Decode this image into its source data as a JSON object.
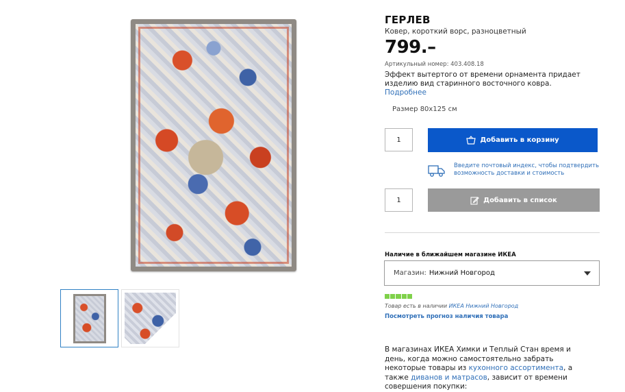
{
  "product": {
    "name": "ГЕРЛЕВ",
    "subtitle": "Ковер, короткий ворс, разноцветный",
    "price": "799.–",
    "article": "Артикульный номер: 403.408.18",
    "description": "Эффект вытертого от времени орнамента придает изделию вид старинного восточного ковра.",
    "more_link": "Подробнее",
    "size": "Размер 80x125 см"
  },
  "gallery": {
    "main_image": "rug-front-image",
    "thumbnails": [
      "rug-thumbnail-front",
      "rug-thumbnail-detail"
    ]
  },
  "purchase": {
    "qty_cart": "1",
    "cart_button": "Добавить в корзину",
    "delivery_text": "Введите почтовый индекс, чтобы подтвердить возможность доставки и стоимость",
    "qty_list": "1",
    "list_button": "Добавить в список"
  },
  "store": {
    "heading": "Наличие в ближайшем магазине ИКЕА",
    "select_label": "Магазин:",
    "select_value": "Нижний Новгород",
    "stock_level": 1.0,
    "stock_text": "Товар есть в наличии",
    "stock_store_link": "ИКЕА Нижний Новгород",
    "forecast_link": "Посмотреть прогноз наличия товара"
  },
  "note": {
    "part1": "В магазинах ИКЕА Химки и Теплый Стан время и день, когда можно самостоятельно забрать некоторые товары из ",
    "link1": "кухонного ассортимента",
    "part2": ", а также ",
    "link2": "диванов и матрасов",
    "part3": ", зависит от времени совершения покупки:"
  },
  "colors": {
    "primary_button": "#0a58ca",
    "secondary_button": "#9a9a9a",
    "link": "#2f6fb8",
    "stock_green": "#7fd14a"
  },
  "icons": {
    "cart": "shopping-bag-icon",
    "list": "edit-list-icon",
    "delivery": "truck-icon",
    "dropdown": "chevron-down-icon"
  }
}
